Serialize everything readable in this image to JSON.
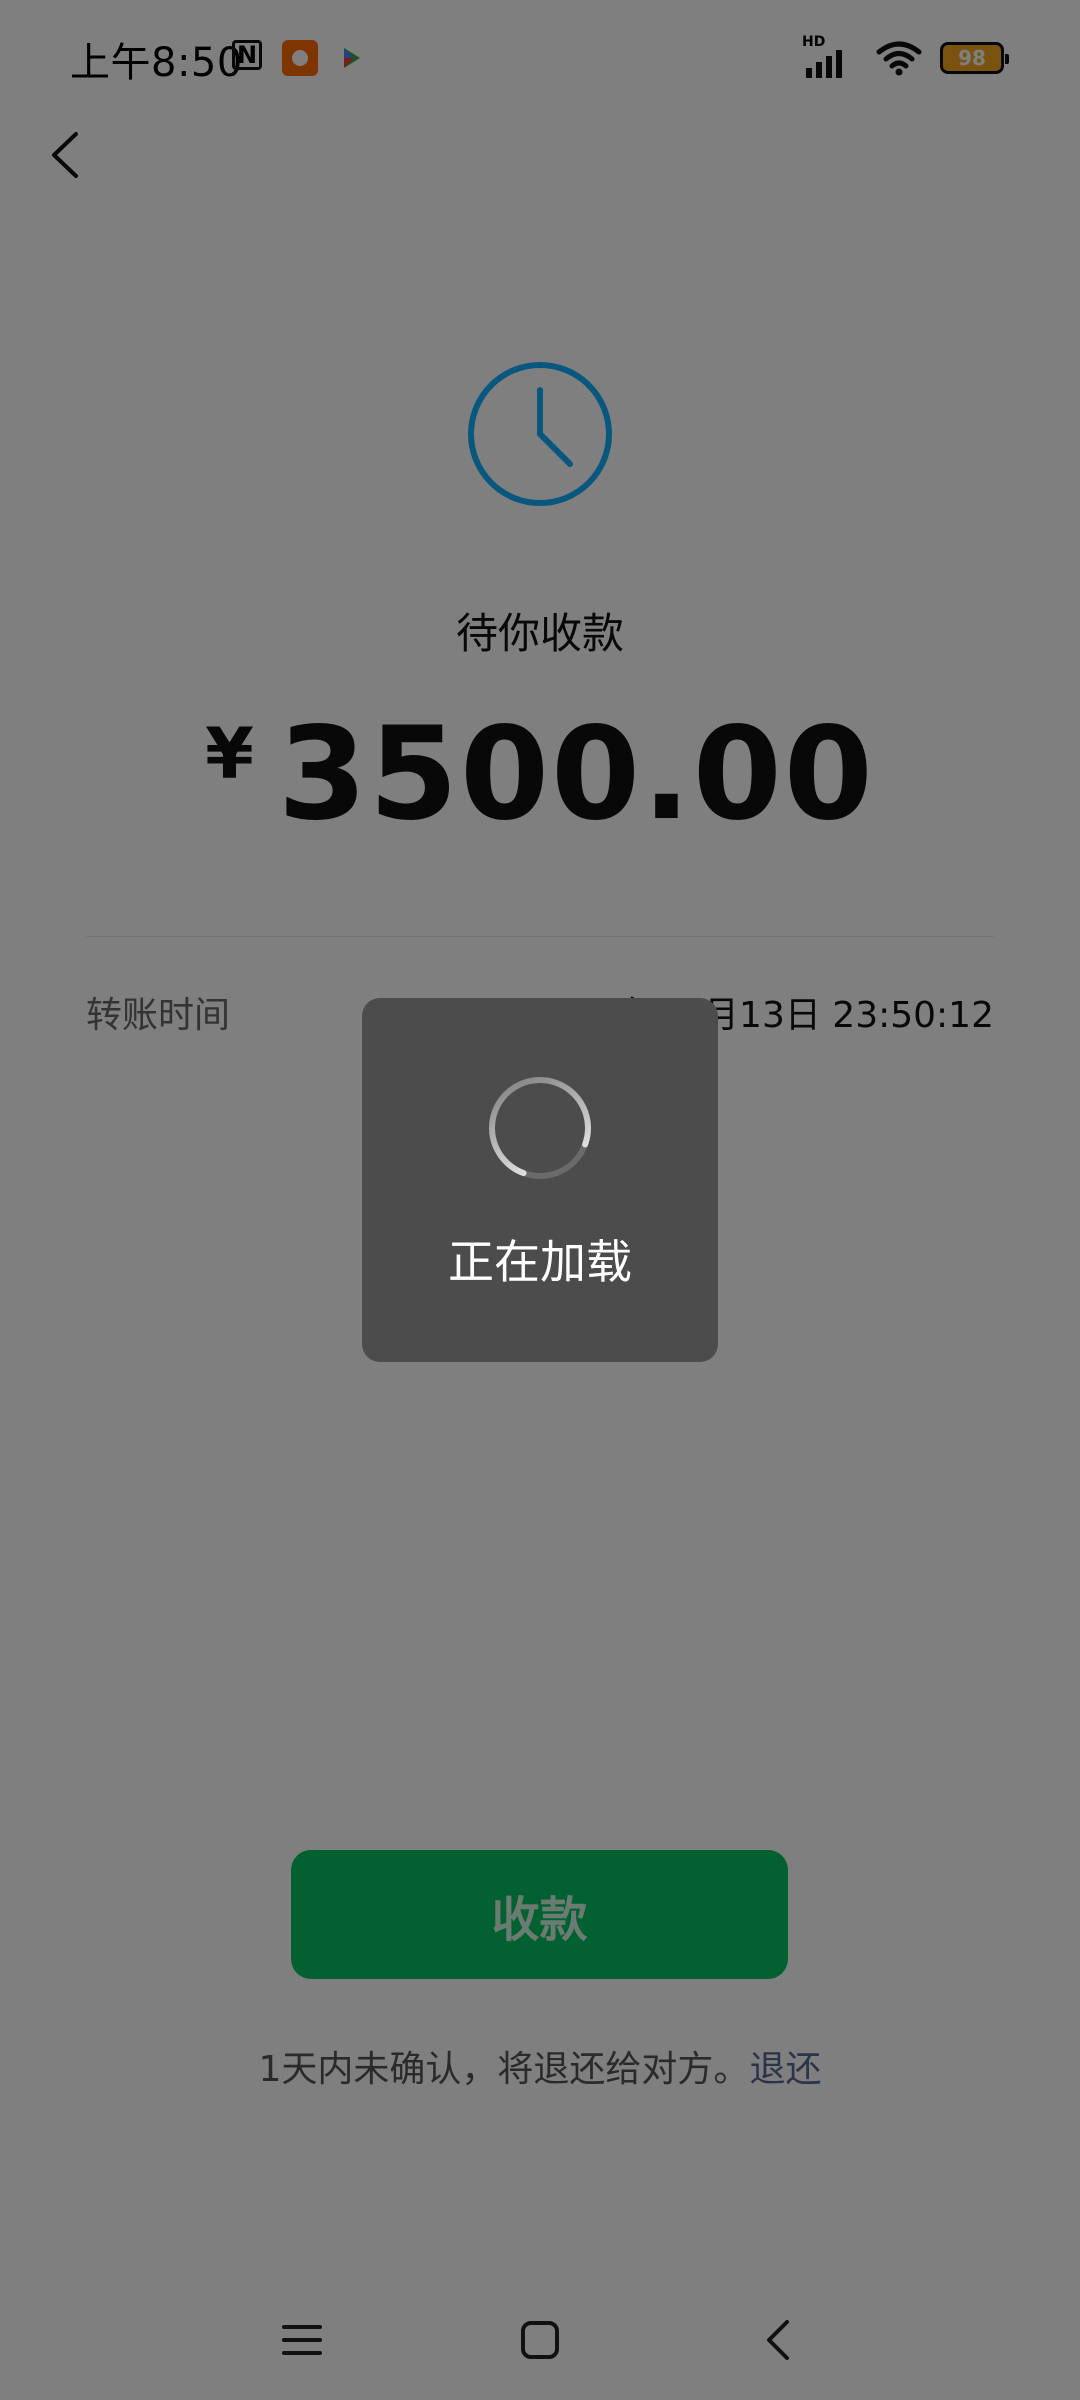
{
  "status_bar": {
    "time": "上午8:50",
    "battery": "98",
    "hd": "HD"
  },
  "transfer": {
    "status": "待你收款",
    "currency": "¥",
    "amount": "3500.00",
    "time_label": "转账时间",
    "time_value": "2025年06月13日 23:50:12",
    "receive_button": "收款",
    "note_text": "1天内未确认，将退还给对方。",
    "refund_link": "退还"
  },
  "loading": {
    "text": "正在加载"
  },
  "colors": {
    "accent_green": "#07c160",
    "link_blue": "#576b95",
    "clock_blue": "#10aeff"
  }
}
